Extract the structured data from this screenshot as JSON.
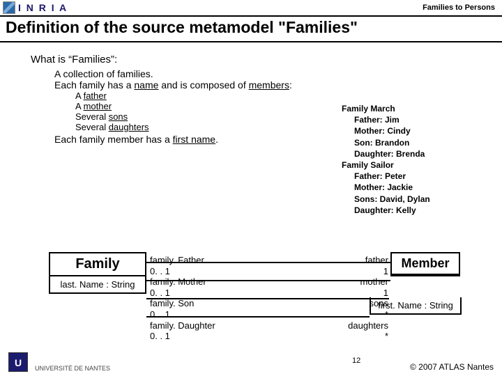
{
  "header": {
    "logo_text": "I N R I A",
    "right": "Families to Persons"
  },
  "title": "Definition of the source metamodel \"Families\"",
  "body": {
    "question": "What is “Families”:",
    "line1a": "A collection of families.",
    "line1b_pre": "Each family has a ",
    "line1b_u": "name",
    "line1b_mid": " and is composed of ",
    "line1b_u2": "members",
    "line1b_post": ":",
    "members": {
      "a_pre": "A ",
      "a_u": "father",
      "b_pre": "A ",
      "b_u": "mother",
      "c_pre": "Several ",
      "c_u": "sons",
      "d_pre": "Several ",
      "d_u": "daughters"
    },
    "line2_pre": "Each family member has a ",
    "line2_u": "first name",
    "line2_post": "."
  },
  "example": {
    "f1": "Family March",
    "f1a": "Father: Jim",
    "f1b": "Mother: Cindy",
    "f1c": "Son: Brandon",
    "f1d": "Daughter: Brenda",
    "f2": "Family Sailor",
    "f2a": "Father: Peter",
    "f2b": "Mother: Jackie",
    "f2c": "Sons: David, Dylan",
    "f2d": "Daughter: Kelly"
  },
  "uml": {
    "family": {
      "name": "Family",
      "attr": "last. Name : String"
    },
    "member": {
      "name": "Member",
      "attr": "first. Name : String"
    },
    "left_roles": {
      "r1": "family. Father",
      "m1": "0. . 1",
      "r2": "family. Mother",
      "m2": "0. . 1",
      "r3": "family. Son",
      "m3": "0. . 1",
      "r4": "family. Daughter",
      "m4": "0. . 1"
    },
    "right_roles": {
      "r1": "father",
      "m1": "1",
      "r2": "mother",
      "m2": "1",
      "r3": "sons",
      "m3": "*",
      "r4": "daughters",
      "m4": "*"
    }
  },
  "footer": {
    "uni": "UNIVERSITÉ DE NANTES",
    "page": "12",
    "copyright": "© 2007 ATLAS Nantes"
  }
}
